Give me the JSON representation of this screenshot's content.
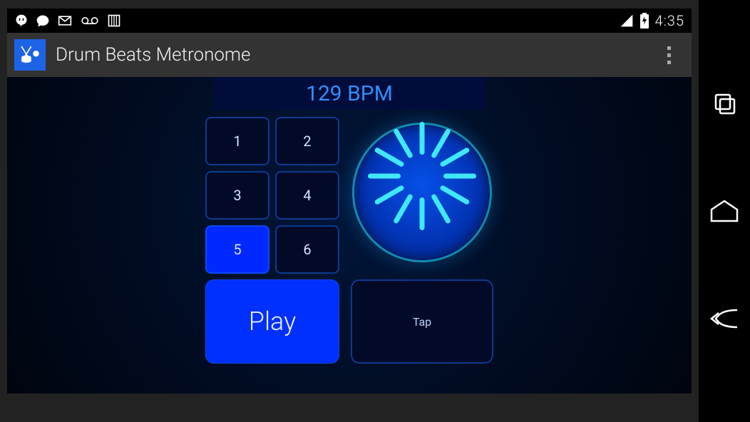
{
  "status": {
    "time": "4:35"
  },
  "app": {
    "title": "Drum Beats Metronome"
  },
  "metronome": {
    "bpm_value": 129,
    "bpm_unit": "BPM",
    "bpm_label": "129 BPM",
    "beats": [
      "1",
      "2",
      "3",
      "4",
      "5",
      "6"
    ],
    "selected_beat_index": 4,
    "play_label": "Play",
    "tap_label": "Tap"
  }
}
